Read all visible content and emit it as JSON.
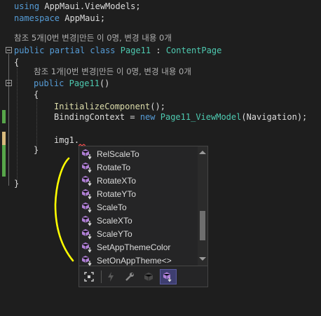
{
  "editor": {
    "using_kw": "using",
    "using_ns": "AppMaui.ViewModels;",
    "namespace_kw": "namespace",
    "namespace_name": "AppMaui;",
    "ref_class": "참조 5개|0번 변경|만든 이 0명, 변경 내용 0개",
    "class_public": "public",
    "class_partial": "partial",
    "class_kw": "class",
    "class_name": "Page11",
    "class_colon": ":",
    "class_base": "ContentPage",
    "brace_open": "{",
    "ref_ctor": "참조 1개|0번 변경|만든 이 0명, 변경 내용 0개",
    "ctor_public": "public",
    "ctor_name": "Page11",
    "ctor_parens": "()",
    "ctor_brace_open": "{",
    "init_call": "InitializeComponent",
    "init_tail": "();",
    "binding_prop": "BindingContext = ",
    "binding_new": "new",
    "binding_type": "Page11_ViewModel",
    "binding_args": "(Navigation);",
    "typed_text": "img1.",
    "ctor_brace_close": "}",
    "class_brace_close": "}"
  },
  "completion": {
    "items": [
      {
        "label": "RelScaleTo",
        "icon": "extension-method-icon"
      },
      {
        "label": "RotateTo",
        "icon": "extension-method-icon"
      },
      {
        "label": "RotateXTo",
        "icon": "extension-method-icon"
      },
      {
        "label": "RotateYTo",
        "icon": "extension-method-icon"
      },
      {
        "label": "ScaleTo",
        "icon": "extension-method-icon"
      },
      {
        "label": "ScaleXTo",
        "icon": "extension-method-icon"
      },
      {
        "label": "ScaleYTo",
        "icon": "extension-method-icon"
      },
      {
        "label": "SetAppThemeColor",
        "icon": "extension-method-icon"
      },
      {
        "label": "SetOnAppTheme<>",
        "icon": "extension-method-icon"
      }
    ],
    "filters": [
      {
        "icon": "target-filter-icon",
        "active": false
      },
      {
        "icon": "event-filter-icon",
        "active": false
      },
      {
        "icon": "wrench-filter-icon",
        "active": false
      },
      {
        "icon": "cube-filter-icon",
        "active": false
      },
      {
        "icon": "extension-method-filter-icon",
        "active": true
      }
    ]
  },
  "colors": {
    "background": "#1e1e1e",
    "keyword": "#569cd6",
    "type": "#4ec9b0",
    "method": "#dcdcaa",
    "annotation_stroke": "#ffff00",
    "change_bar_green": "#57a64a",
    "change_bar_yellow": "#d7ba7d"
  }
}
